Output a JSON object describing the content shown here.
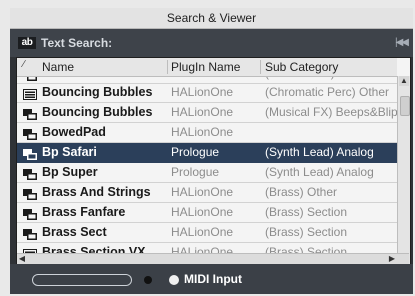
{
  "window": {
    "title": "Search & Viewer"
  },
  "search": {
    "label": "Text Search:",
    "ab_icon": "ab-text-search-icon"
  },
  "columns": [
    "Name",
    "PlugIn Name",
    "Sub Category"
  ],
  "rows": [
    {
      "name": "Bottle",
      "plugin": "HALionOne",
      "sub": "(Woodwinds) Flute",
      "icon": "keyboard-icon",
      "partial": true
    },
    {
      "name": "Bouncing Bubbles",
      "plugin": "HALionOne",
      "sub": "(Chromatic Perc) Other",
      "icon": "list-icon"
    },
    {
      "name": "Bouncing Bubbles",
      "plugin": "HALionOne",
      "sub": "(Musical FX) Beeps&Blips",
      "icon": "keyboard-icon"
    },
    {
      "name": "BowedPad",
      "plugin": "HALionOne",
      "sub": "",
      "icon": "keyboard-icon"
    },
    {
      "name": "Bp Safari",
      "plugin": "Prologue",
      "sub": "(Synth Lead) Analog",
      "icon": "keyboard-icon",
      "selected": true
    },
    {
      "name": "Bp Super",
      "plugin": "Prologue",
      "sub": "(Synth Lead) Analog",
      "icon": "keyboard-icon"
    },
    {
      "name": "Brass And Strings",
      "plugin": "HALionOne",
      "sub": "(Brass) Other",
      "icon": "keyboard-icon"
    },
    {
      "name": "Brass Fanfare",
      "plugin": "HALionOne",
      "sub": "(Brass) Section",
      "icon": "keyboard-icon"
    },
    {
      "name": "Brass Sect",
      "plugin": "HALionOne",
      "sub": "(Brass) Section",
      "icon": "keyboard-icon"
    },
    {
      "name": "Brass Section VX",
      "plugin": "HALionOne",
      "sub": "(Brass) Section",
      "icon": "list-icon"
    }
  ],
  "bottom": {
    "midi_label": "MIDI Input"
  },
  "colors": {
    "selected_row": "#2b3f5a",
    "panel": "#2f3236",
    "searchbar": "#3e434a"
  }
}
